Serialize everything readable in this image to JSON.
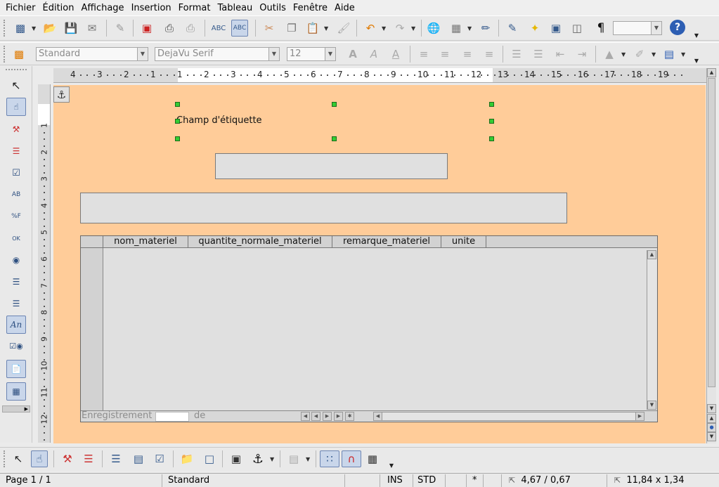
{
  "menubar": {
    "items": [
      "Fichier",
      "Édition",
      "Affichage",
      "Insertion",
      "Format",
      "Tableau",
      "Outils",
      "Fenêtre",
      "Aide"
    ]
  },
  "formatting": {
    "paragraph_style": "Standard",
    "font_name": "DejaVu Serif",
    "font_size": "12"
  },
  "toolbar": {
    "zoom_value": "",
    "help_glyph": "?",
    "pilcrow_glyph": "¶"
  },
  "ruler": {
    "horizontal_labels": [
      "4",
      "3",
      "2",
      "1",
      "1",
      "2",
      "3",
      "4",
      "5",
      "6",
      "7",
      "8",
      "9",
      "10",
      "11",
      "12",
      "13",
      "14",
      "15",
      "16",
      "17",
      "18",
      "19"
    ],
    "vertical_labels": [
      "1",
      "2",
      "3",
      "4",
      "5",
      "6",
      "7",
      "8",
      "9",
      "10",
      "11",
      "12"
    ]
  },
  "form": {
    "label_field_text": "Champ d'étiquette",
    "grid": {
      "columns": [
        "nom_materiel",
        "quantite_normale_materiel",
        "remarque_materiel",
        "unite"
      ],
      "nav_record_label": "Enregistrement",
      "nav_of_label": "de"
    }
  },
  "left_toolbar": {
    "font_icon_label": "An",
    "textbox_icon_label": "AB",
    "formatted_icon_label": "%F",
    "button_icon_label": "OK"
  },
  "statusbar": {
    "page": "Page 1 / 1",
    "page_style": "Standard",
    "insert_mode": "INS",
    "selection_mode": "STD",
    "modified": "*",
    "position": "4,67 / 0,67",
    "size": "11,84 x 1,34"
  }
}
